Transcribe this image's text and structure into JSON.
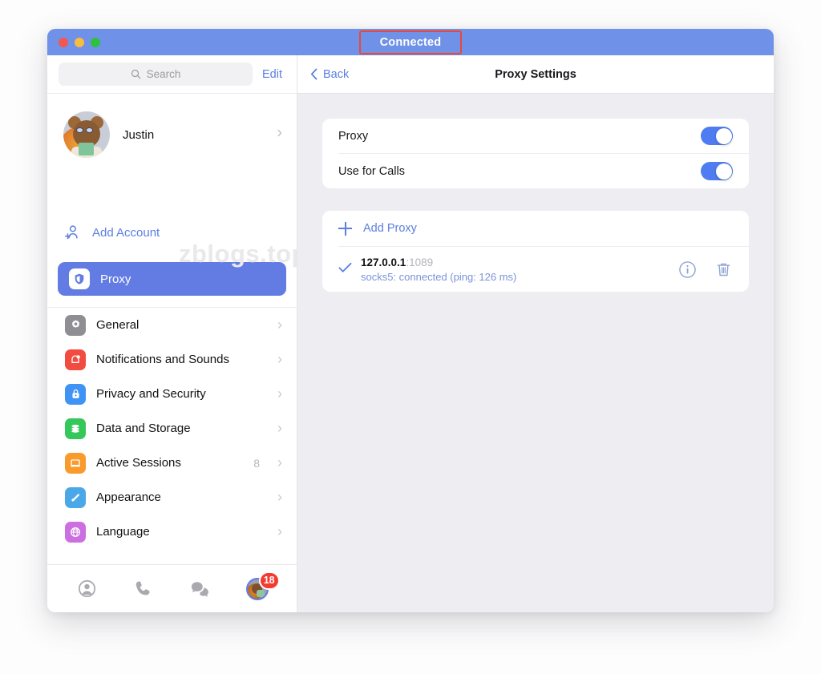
{
  "window": {
    "titlebar": {
      "status_badge": "Connected",
      "lights": [
        "close",
        "minimize",
        "zoom"
      ]
    }
  },
  "sidebar": {
    "search": {
      "placeholder": "Search",
      "icon": "search-icon"
    },
    "edit_label": "Edit",
    "profile": {
      "name": "Justin",
      "chevron": "›"
    },
    "watermark": "zblogs.top",
    "add_account": {
      "label": "Add Account",
      "icon": "person-add-icon"
    },
    "proxy_item": {
      "label": "Proxy",
      "icon": "shield-icon"
    },
    "items": [
      {
        "label": "General",
        "icon": "gear-icon",
        "count": "",
        "chevron": "›"
      },
      {
        "label": "Notifications and Sounds",
        "icon": "bell-icon",
        "count": "",
        "chevron": "›"
      },
      {
        "label": "Privacy and Security",
        "icon": "lock-icon",
        "count": "",
        "chevron": "›"
      },
      {
        "label": "Data and Storage",
        "icon": "database-icon",
        "count": "",
        "chevron": "›"
      },
      {
        "label": "Active Sessions",
        "icon": "laptop-icon",
        "count": "8",
        "chevron": "›"
      },
      {
        "label": "Appearance",
        "icon": "paintbrush-icon",
        "count": "",
        "chevron": "›"
      },
      {
        "label": "Language",
        "icon": "globe-icon",
        "count": "",
        "chevron": "›"
      }
    ],
    "tabs": [
      {
        "name": "contacts-tab",
        "icon": "person-icon"
      },
      {
        "name": "calls-tab",
        "icon": "phone-icon"
      },
      {
        "name": "chats-tab",
        "icon": "chat-bubbles-icon"
      },
      {
        "name": "settings-tab",
        "icon": "avatar-icon",
        "badge": "18"
      }
    ]
  },
  "main": {
    "back_label": "Back",
    "title": "Proxy Settings",
    "settings_card": [
      {
        "label": "Proxy",
        "toggle": "on"
      },
      {
        "label": "Use for Calls",
        "toggle": "on"
      }
    ],
    "add_proxy_label": "Add Proxy",
    "proxy_entry": {
      "selected": true,
      "host": "127.0.0.1",
      "port": ":1089",
      "status": "socks5: connected (ping: 126 ms)",
      "info_icon": "info-icon",
      "delete_icon": "trash-icon"
    }
  },
  "colors": {
    "accent": "#5b7fe0",
    "titlebar": "#6f91e8",
    "annotation": "#e8483c",
    "toggle_on": "#4f7cf0",
    "badge": "#f33b30",
    "main_bg": "#eeedf2"
  }
}
